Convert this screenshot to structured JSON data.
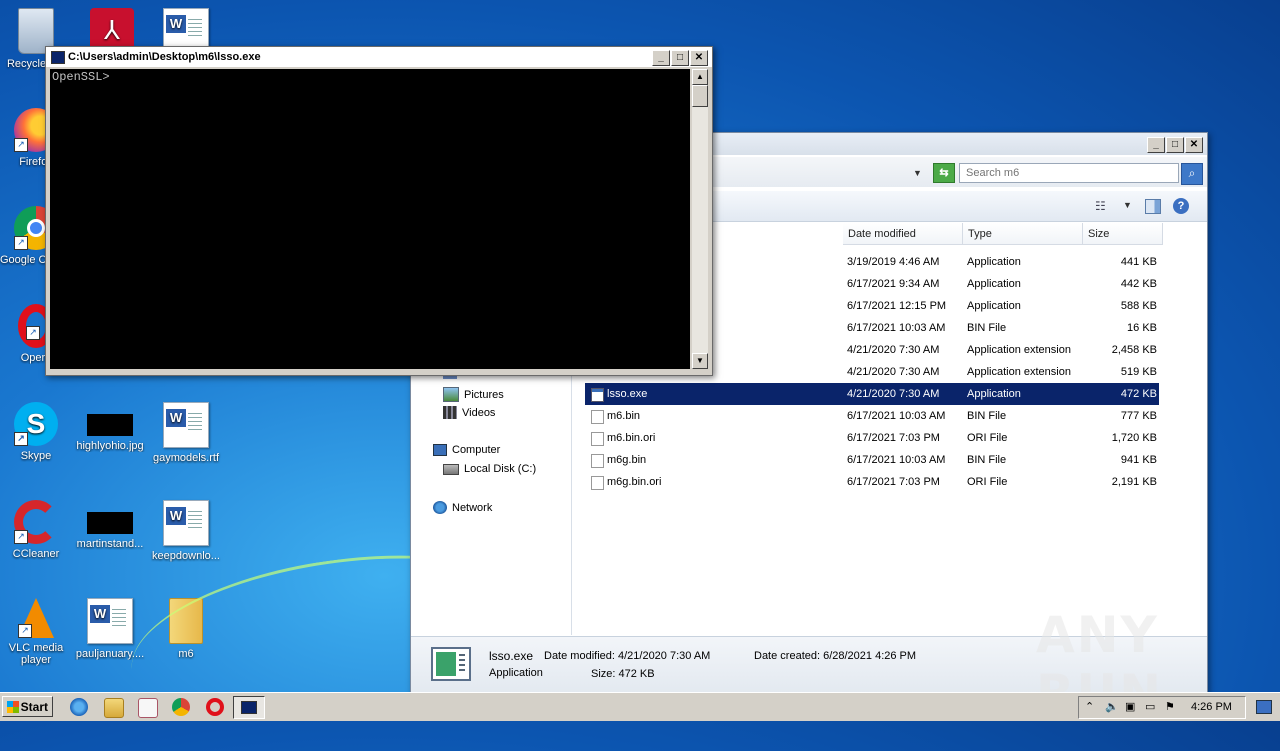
{
  "desktop": {
    "icons": [
      {
        "label": "Recycle Bin",
        "icon": "recycle-bin-icon"
      },
      {
        "label": "",
        "icon": "acrobat-icon"
      },
      {
        "label": "",
        "icon": "word-doc-icon"
      },
      {
        "label": "Firefox",
        "icon": "firefox-icon"
      },
      {
        "label": "Google Chrome",
        "icon": "chrome-icon"
      },
      {
        "label": "Opera",
        "icon": "opera-icon"
      },
      {
        "label": "Skype",
        "icon": "skype-icon"
      },
      {
        "label": "highlyohio.jpg",
        "icon": "image-file-icon"
      },
      {
        "label": "gaymodels.rtf",
        "icon": "word-doc-icon"
      },
      {
        "label": "CCleaner",
        "icon": "ccleaner-icon"
      },
      {
        "label": "martinstand...",
        "icon": "image-file-icon"
      },
      {
        "label": "keepdownlo...",
        "icon": "word-doc-icon"
      },
      {
        "label": "VLC media player",
        "icon": "vlc-icon"
      },
      {
        "label": "pauljanuary....",
        "icon": "word-doc-icon"
      },
      {
        "label": "m6",
        "icon": "folder-icon"
      }
    ]
  },
  "console": {
    "title": "C:\\Users\\admin\\Desktop\\m6\\lsso.exe",
    "output": "OpenSSL>",
    "buttons": {
      "minimize": "_",
      "maximize": "□",
      "close": "✕"
    }
  },
  "explorer": {
    "search_placeholder": "Search m6",
    "columns": {
      "date": "Date modified",
      "type": "Type",
      "size": "Size"
    },
    "nav": {
      "music": "Music",
      "pictures": "Pictures",
      "videos": "Videos",
      "computer": "Computer",
      "local_disk": "Local Disk (C:)",
      "network": "Network"
    },
    "files": [
      {
        "name": "",
        "date": "3/19/2019 4:46 AM",
        "type": "Application",
        "size": "441 KB"
      },
      {
        "name": "",
        "date": "6/17/2021 9:34 AM",
        "type": "Application",
        "size": "442 KB"
      },
      {
        "name": "",
        "date": "6/17/2021 12:15 PM",
        "type": "Application",
        "size": "588 KB"
      },
      {
        "name": "",
        "date": "6/17/2021 10:03 AM",
        "type": "BIN File",
        "size": "16 KB"
      },
      {
        "name": "",
        "date": "4/21/2020 7:30 AM",
        "type": "Application extension",
        "size": "2,458 KB"
      },
      {
        "name": "",
        "date": "4/21/2020 7:30 AM",
        "type": "Application extension",
        "size": "519 KB"
      },
      {
        "name": "lsso.exe",
        "date": "4/21/2020 7:30 AM",
        "type": "Application",
        "size": "472 KB"
      },
      {
        "name": "m6.bin",
        "date": "6/17/2021 10:03 AM",
        "type": "BIN File",
        "size": "777 KB"
      },
      {
        "name": "m6.bin.ori",
        "date": "6/17/2021 7:03 PM",
        "type": "ORI File",
        "size": "1,720 KB"
      },
      {
        "name": "m6g.bin",
        "date": "6/17/2021 10:03 AM",
        "type": "BIN File",
        "size": "941 KB"
      },
      {
        "name": "m6g.bin.ori",
        "date": "6/17/2021 7:03 PM",
        "type": "ORI File",
        "size": "2,191 KB"
      }
    ],
    "details": {
      "name": "lsso.exe",
      "kind": "Application",
      "modified": "Date modified: 4/21/2020 7:30 AM",
      "created": "Date created: 6/28/2021 4:26 PM",
      "size": "Size: 472 KB"
    }
  },
  "watermark": "ANY RUN",
  "taskbar": {
    "start": "Start",
    "clock": "4:26 PM"
  }
}
